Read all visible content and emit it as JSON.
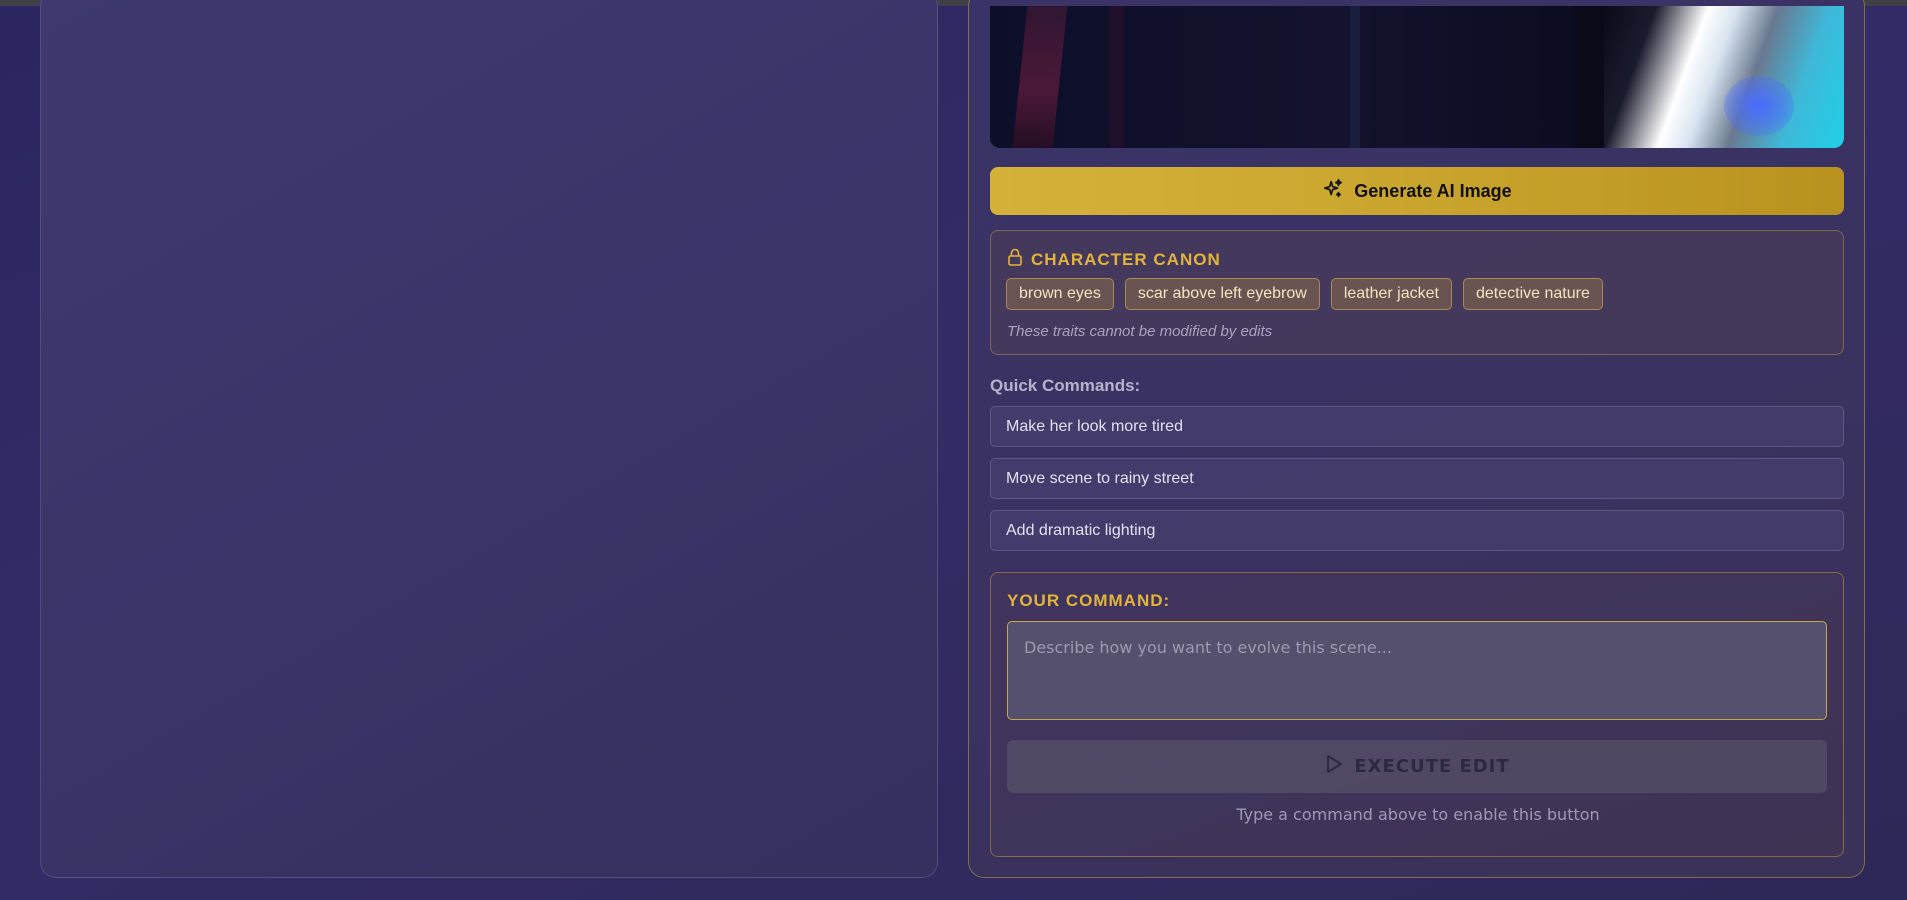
{
  "generate_button": {
    "label": "Generate AI Image",
    "icon": "sparkles-icon"
  },
  "character_canon": {
    "icon": "lock-icon",
    "title": "CHARACTER CANON",
    "traits": [
      "brown eyes",
      "scar above left eyebrow",
      "leather jacket",
      "detective nature"
    ],
    "note": "These traits cannot be modified by edits"
  },
  "quick_commands": {
    "label": "Quick Commands:",
    "items": [
      "Make her look more tired",
      "Move scene to rainy street",
      "Add dramatic lighting"
    ]
  },
  "command": {
    "label": "YOUR COMMAND:",
    "placeholder": "Describe how you want to evolve this scene...",
    "value": "",
    "execute_label": "EXECUTE EDIT",
    "execute_icon": "play-icon",
    "hint": "Type a command above to enable this button"
  },
  "colors": {
    "accent": "#e2b43a",
    "button_gold": "#c9a52e",
    "background": "#2f2960"
  }
}
